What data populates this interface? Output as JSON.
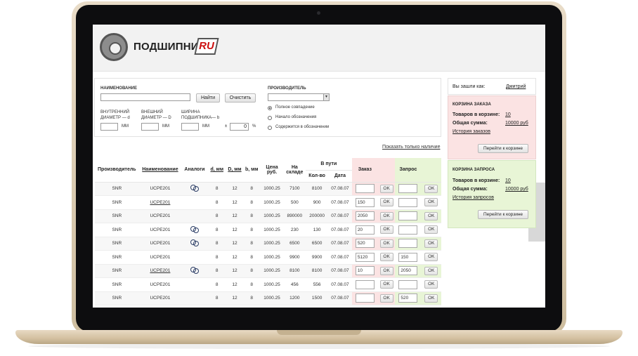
{
  "brand": {
    "name": "ПОДШИПНИК",
    "suffix": "RU"
  },
  "filter": {
    "name_label": "НАИМЕНОВАНИЕ",
    "name_value": "",
    "find_button": "Найти",
    "clear_button": "Очистить",
    "manufacturer_label": "ПРОИЗВОДИТЕЛЬ",
    "manufacturer_value": "",
    "match_options": [
      {
        "label": "Полное совпадение",
        "selected": true
      },
      {
        "label": "Начало обозначения",
        "selected": false
      },
      {
        "label": "Содержится в обозначении",
        "selected": false
      }
    ],
    "inner_diameter_label": "ВНУТРЕННИЙ ДИАМЕТР — d",
    "outer_diameter_label": "ВНЕШНИЙ ДИАМЕТР — D",
    "width_label": "ШИРИНА ПОДШИПНИКА— b",
    "mm_unit": "ММ",
    "tolerance_sign": "±",
    "tolerance_value": "0",
    "percent": "%"
  },
  "stock_link": "Показать только наличие",
  "table": {
    "headers": {
      "manufacturer": "Производитель",
      "name": "Наименование",
      "analogs": "Аналоги",
      "d": "d, мм",
      "D": "D, мм",
      "b": "b, мм",
      "price": "Цена руб.",
      "in_stock": "На складе",
      "in_transit": "В пути",
      "qty": "Кол-во",
      "date": "Дата",
      "order": "Заказ",
      "request": "Запрос"
    },
    "ok_label": "OK",
    "rows": [
      {
        "manufacturer": "SNR",
        "name": "UCPE201",
        "name_link": false,
        "analog": true,
        "d": "8",
        "D": "12",
        "b": "8",
        "price": "1000.25",
        "stock": "7100",
        "transit_qty": "8100",
        "date": "07.08.07",
        "order": "",
        "request": ""
      },
      {
        "manufacturer": "SNR",
        "name": "UCPE201",
        "name_link": true,
        "analog": false,
        "d": "8",
        "D": "12",
        "b": "8",
        "price": "1000.25",
        "stock": "500",
        "transit_qty": "900",
        "date": "07.08.07",
        "order": "150",
        "request": ""
      },
      {
        "manufacturer": "SNR",
        "name": "UCPE201",
        "name_link": false,
        "analog": false,
        "d": "8",
        "D": "12",
        "b": "8",
        "price": "1000.25",
        "stock": "890000",
        "transit_qty": "200000",
        "date": "07.08.07",
        "order": "2050",
        "request": ""
      },
      {
        "manufacturer": "SNR",
        "name": "UCPE201",
        "name_link": false,
        "analog": true,
        "d": "8",
        "D": "12",
        "b": "8",
        "price": "1000.25",
        "stock": "230",
        "transit_qty": "130",
        "date": "07.08.07",
        "order": "20",
        "request": ""
      },
      {
        "manufacturer": "SNR",
        "name": "UCPE201",
        "name_link": false,
        "analog": true,
        "d": "8",
        "D": "12",
        "b": "8",
        "price": "1000.25",
        "stock": "6500",
        "transit_qty": "6500",
        "date": "07.08.07",
        "order": "520",
        "request": ""
      },
      {
        "manufacturer": "SNR",
        "name": "UCPE201",
        "name_link": false,
        "analog": false,
        "d": "8",
        "D": "12",
        "b": "8",
        "price": "1000.25",
        "stock": "9900",
        "transit_qty": "9900",
        "date": "07.08.07",
        "order": "5120",
        "request": "150"
      },
      {
        "manufacturer": "SNR",
        "name": "UCPE201",
        "name_link": true,
        "analog": true,
        "d": "8",
        "D": "12",
        "b": "8",
        "price": "1000.25",
        "stock": "8100",
        "transit_qty": "8100",
        "date": "07.08.07",
        "order": "10",
        "request": "2050"
      },
      {
        "manufacturer": "SNR",
        "name": "UCPE201",
        "name_link": false,
        "analog": false,
        "d": "8",
        "D": "12",
        "b": "8",
        "price": "1000.25",
        "stock": "456",
        "transit_qty": "556",
        "date": "07.08.07",
        "order": "",
        "request": ""
      },
      {
        "manufacturer": "SNR",
        "name": "UCPE201",
        "name_link": false,
        "analog": false,
        "d": "8",
        "D": "12",
        "b": "8",
        "price": "1000.25",
        "stock": "1200",
        "transit_qty": "1500",
        "date": "07.08.07",
        "order": "",
        "request": "520"
      }
    ]
  },
  "sidebar": {
    "logged_in_label": "Вы зашли как:",
    "user_name": "Дмитрий",
    "order_cart": {
      "title": "КОРЗИНА ЗАКАЗА",
      "items_label": "Товаров в корзине:",
      "items_value": "10",
      "sum_label": "Общая сумма:",
      "sum_value": "10000 руб",
      "history_link": "История заказов",
      "button": "Перейти к корзине"
    },
    "request_cart": {
      "title": "КОРЗИНА ЗАПРОСА",
      "items_label": "Товаров в корзине:",
      "items_value": "10",
      "sum_label": "Общая сумма:",
      "sum_value": "10000 руб",
      "history_link": "История запросов",
      "button": "Перейти к корзине"
    }
  },
  "colors": {
    "order_bg": "#fbe3e3",
    "request_bg": "#e8f5d6",
    "logo_accent": "#cc1010",
    "laptop_gold": "#d8c6a6"
  }
}
